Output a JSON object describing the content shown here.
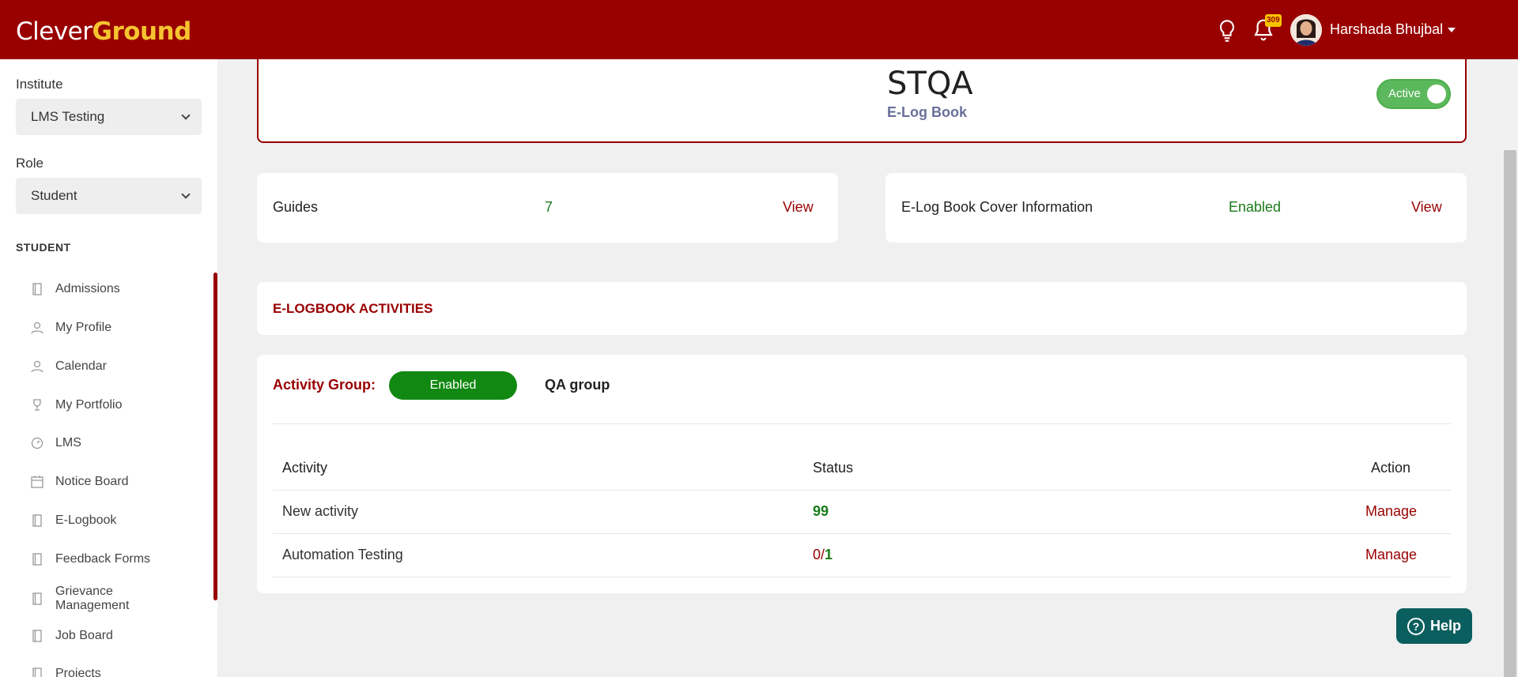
{
  "topbar": {
    "logo_part1": "Clever",
    "logo_part2": "Ground",
    "notification_count": "309",
    "user_name": "Harshada Bhujbal",
    "icons": [
      "lightbulb-icon",
      "bell-icon",
      "avatar",
      "caret-down-icon"
    ]
  },
  "sidebar": {
    "institute_label": "Institute",
    "institute_value": "LMS Testing",
    "role_label": "Role",
    "role_value": "Student",
    "section_title": "STUDENT",
    "items": [
      {
        "label": "Admissions",
        "icon": "book-icon"
      },
      {
        "label": "My Profile",
        "icon": "user-icon"
      },
      {
        "label": "Calendar",
        "icon": "user-icon"
      },
      {
        "label": "My Portfolio",
        "icon": "trophy-icon"
      },
      {
        "label": "LMS",
        "icon": "gauge-icon"
      },
      {
        "label": "Notice Board",
        "icon": "calendar-icon"
      },
      {
        "label": "E-Logbook",
        "icon": "book-icon"
      },
      {
        "label": "Feedback Forms",
        "icon": "book-icon"
      },
      {
        "label": "Grievance",
        "label2": "Management",
        "icon": "book-icon"
      },
      {
        "label": "Job Board",
        "icon": "book-icon"
      },
      {
        "label": "Projects",
        "icon": "book-icon"
      }
    ]
  },
  "header": {
    "title": "STQA",
    "subtitle": "E-Log Book",
    "toggle_label": "Active"
  },
  "guides_card": {
    "label": "Guides",
    "value": "7",
    "link": "View"
  },
  "cover_card": {
    "label": "E-Log Book Cover Information",
    "value": "Enabled",
    "link": "View"
  },
  "activities_section": {
    "title": "E-LOGBOOK ACTIVITIES"
  },
  "activity_group": {
    "label": "Activity Group:",
    "status": "Enabled",
    "name": "QA group",
    "columns": [
      "Activity",
      "Status",
      "Action"
    ],
    "rows": [
      {
        "activity": "New activity",
        "status": "99",
        "action": "Manage"
      },
      {
        "activity": "Automation Testing",
        "status_done": "0",
        "status_sep": "/",
        "status_total": "1",
        "action": "Manage"
      }
    ]
  },
  "help": {
    "label": "Help"
  },
  "colors": {
    "brand": "#990000",
    "accent_yellow": "#f5c430",
    "enabled_green": "#118811",
    "help_teal": "#0b5e5e"
  }
}
